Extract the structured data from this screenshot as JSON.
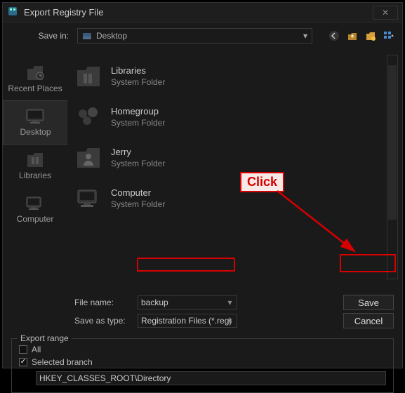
{
  "window": {
    "title": "Export Registry File"
  },
  "savein": {
    "label": "Save in:",
    "value": "Desktop"
  },
  "places": [
    {
      "name": "Recent Places",
      "selected": false
    },
    {
      "name": "Desktop",
      "selected": true
    },
    {
      "name": "Libraries",
      "selected": false
    },
    {
      "name": "Computer",
      "selected": false
    }
  ],
  "folders": [
    {
      "name": "Libraries",
      "type": "System Folder"
    },
    {
      "name": "Homegroup",
      "type": "System Folder"
    },
    {
      "name": "Jerry",
      "type": "System Folder"
    },
    {
      "name": "Computer",
      "type": "System Folder"
    }
  ],
  "fields": {
    "filename_label": "File name:",
    "filename_value": "backup",
    "savetype_label": "Save as type:",
    "savetype_value": "Registration Files (*.reg)"
  },
  "buttons": {
    "save": "Save",
    "cancel": "Cancel"
  },
  "export": {
    "legend": "Export range",
    "all_label": "All",
    "all_checked": false,
    "branch_label": "Selected branch",
    "branch_checked": true,
    "branch_value": "HKEY_CLASSES_ROOT\\Directory"
  },
  "annotation": {
    "click": "Click"
  }
}
